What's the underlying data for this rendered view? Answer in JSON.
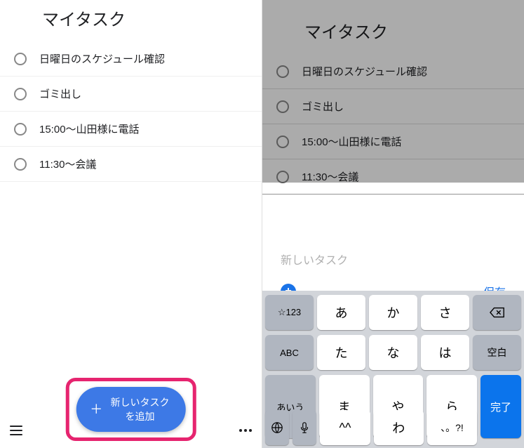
{
  "left": {
    "title": "マイタスク",
    "tasks": [
      "日曜日のスケジュール確認",
      "ゴミ出し",
      "15:00〜山田様に電話",
      "11:30〜会議"
    ],
    "add_button": "新しいタスクを追加"
  },
  "right": {
    "title": "マイタスク",
    "tasks": [
      "日曜日のスケジュール確認",
      "ゴミ出し",
      "15:00〜山田様に電話",
      "11:30〜会議"
    ],
    "input_placeholder": "新しいタスク",
    "save": "保存",
    "keyboard": {
      "left_col": [
        "☆123",
        "ABC",
        "あいう"
      ],
      "rows": [
        [
          "あ",
          "か",
          "さ"
        ],
        [
          "た",
          "な",
          "は"
        ],
        [
          "ま",
          "や",
          "ら"
        ],
        [
          "^^",
          "わ",
          "、。?!"
        ]
      ],
      "right_col": [
        "空白",
        "完了"
      ],
      "bottom_left_globe": "🌐",
      "bottom_left_mic": "🎤"
    }
  }
}
